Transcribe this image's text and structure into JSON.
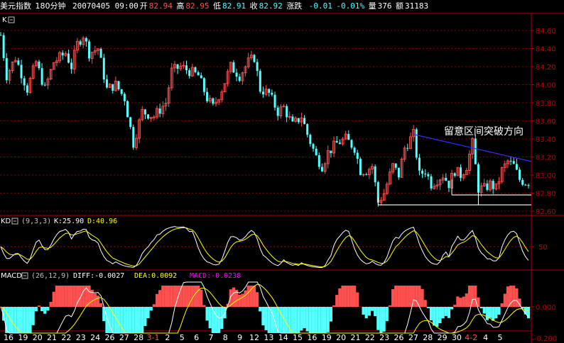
{
  "header": {
    "symbol": "美元指数",
    "period": "180分钟",
    "date_time": "20070405 09:00",
    "open_label": "开",
    "open_value": "82.94",
    "high_label": "高",
    "high_value": "82.95",
    "low_label": "低",
    "low_value": "82.91",
    "close_label": "收",
    "close_value": "82.92",
    "change_label": "涨跌",
    "change_value": "-0.01",
    "change_pct": "-0.01%",
    "volume_label": "量",
    "volume_value": "376",
    "amount_label": "额",
    "amount_value": "31183"
  },
  "panes": {
    "main": {
      "label": "K"
    },
    "kd": {
      "label": "KD",
      "params": "(9,3,3)",
      "k_text": "K:25.90",
      "d_text": "D:40.96"
    },
    "macd": {
      "label": "MACD",
      "params": "(26,12,9)",
      "diff_text": "DIFF:-0.0027",
      "dea_text": "DEA:0.0092",
      "macd_text": "MACD:-0.0238"
    }
  },
  "colors": {
    "up": "#ff5050",
    "down": "#54ffff",
    "white": "#ffffff",
    "yellow": "#ffff00",
    "magenta": "#ff00ff",
    "axis": "#b00000",
    "trend": "#3030ff",
    "tick": "#c00000"
  },
  "annotation": "留意区间突破方向",
  "chart_data": [
    {
      "type": "candlestick",
      "title": "美元指数 180分钟",
      "ylim": [
        82.6,
        84.7
      ],
      "y_ticks": [
        "84.60",
        "84.40",
        "84.20",
        "84.00",
        "83.80",
        "83.60",
        "83.40",
        "83.20",
        "83.00",
        "82.80",
        "82.60"
      ],
      "waypoints": [
        [
          0,
          84.55
        ],
        [
          2,
          84.1
        ],
        [
          5,
          84.3
        ],
        [
          9,
          83.95
        ],
        [
          12,
          84.25
        ],
        [
          15,
          83.95
        ],
        [
          18,
          84.25
        ],
        [
          22,
          84.35
        ],
        [
          24,
          84.2
        ],
        [
          26,
          84.45
        ],
        [
          28,
          84.55
        ],
        [
          30,
          84.35
        ],
        [
          33,
          84.4
        ],
        [
          36,
          83.95
        ],
        [
          39,
          84.0
        ],
        [
          42,
          83.85
        ],
        [
          45,
          83.35
        ],
        [
          48,
          83.7
        ],
        [
          52,
          83.65
        ],
        [
          56,
          83.8
        ],
        [
          58,
          84.15
        ],
        [
          61,
          84.2
        ],
        [
          64,
          84.15
        ],
        [
          67,
          84.1
        ],
        [
          70,
          83.85
        ],
        [
          72,
          83.75
        ],
        [
          75,
          83.95
        ],
        [
          78,
          84.2
        ],
        [
          81,
          84.1
        ],
        [
          84,
          84.25
        ],
        [
          86,
          84.3
        ],
        [
          88,
          83.95
        ],
        [
          91,
          83.9
        ],
        [
          94,
          83.7
        ],
        [
          96,
          83.75
        ],
        [
          99,
          83.55
        ],
        [
          102,
          83.65
        ],
        [
          104,
          83.45
        ],
        [
          107,
          83.2
        ],
        [
          109,
          83.1
        ],
        [
          111,
          83.25
        ],
        [
          114,
          83.35
        ],
        [
          117,
          83.4
        ],
        [
          120,
          83.3
        ],
        [
          122,
          83.05
        ],
        [
          124,
          83.05
        ],
        [
          126,
          83.1
        ],
        [
          128,
          82.7
        ],
        [
          130,
          82.8
        ],
        [
          133,
          83.1
        ],
        [
          135,
          83.0
        ],
        [
          137,
          83.3
        ],
        [
          139,
          83.4
        ],
        [
          140,
          83.45
        ],
        [
          142,
          83.0
        ],
        [
          144,
          83.05
        ],
        [
          146,
          82.9
        ],
        [
          148,
          82.95
        ],
        [
          150,
          83.0
        ],
        [
          152,
          82.9
        ],
        [
          154,
          83.05
        ],
        [
          156,
          83.0
        ],
        [
          158,
          83.1
        ],
        [
          160,
          83.35
        ],
        [
          162,
          82.85
        ],
        [
          164,
          82.85
        ],
        [
          166,
          82.9
        ],
        [
          168,
          82.85
        ],
        [
          170,
          83.05
        ],
        [
          172,
          83.15
        ],
        [
          174,
          83.1
        ],
        [
          176,
          82.95
        ],
        [
          178,
          82.92
        ]
      ],
      "trendlines": [
        {
          "name": "resistance",
          "from": [
            140,
            83.45
          ],
          "to": [
            190,
            83.15
          ]
        },
        {
          "name": "support-1",
          "from": [
            153,
            82.78
          ],
          "to": [
            190,
            82.78
          ]
        },
        {
          "name": "support-2",
          "from": [
            128,
            82.67
          ],
          "to": [
            190,
            82.67
          ]
        }
      ]
    },
    {
      "type": "line",
      "title": "KD (9,3,3)",
      "series": [
        {
          "name": "K",
          "value": 25.9
        },
        {
          "name": "D",
          "value": 40.96
        }
      ],
      "y_ticks": [
        "50"
      ]
    },
    {
      "type": "bar",
      "title": "MACD (26,12,9)",
      "series": [
        {
          "name": "DIFF",
          "value": -0.0027
        },
        {
          "name": "DEA",
          "value": 0.0092
        },
        {
          "name": "MACD",
          "value": -0.0238
        }
      ],
      "y_ticks": [
        "0.000",
        "-0.200"
      ],
      "x_labels": [
        {
          "t": "16",
          "red": false
        },
        {
          "t": "19",
          "red": false
        },
        {
          "t": "20",
          "red": false
        },
        {
          "t": "21",
          "red": false
        },
        {
          "t": "22",
          "red": false
        },
        {
          "t": "23",
          "red": false
        },
        {
          "t": "24",
          "red": false
        },
        {
          "t": "26",
          "red": false
        },
        {
          "t": "27",
          "red": false
        },
        {
          "t": "28",
          "red": false
        },
        {
          "t": "3-1",
          "red": true
        },
        {
          "t": "2",
          "red": false
        },
        {
          "t": "5",
          "red": false
        },
        {
          "t": "6",
          "red": false
        },
        {
          "t": "7",
          "red": false
        },
        {
          "t": "8",
          "red": false
        },
        {
          "t": "9",
          "red": false
        },
        {
          "t": "12",
          "red": false
        },
        {
          "t": "13",
          "red": false
        },
        {
          "t": "14",
          "red": false
        },
        {
          "t": "15",
          "red": false
        },
        {
          "t": "16",
          "red": false
        },
        {
          "t": "19",
          "red": false
        },
        {
          "t": "20",
          "red": false
        },
        {
          "t": "21",
          "red": false
        },
        {
          "t": "22",
          "red": false
        },
        {
          "t": "23",
          "red": false
        },
        {
          "t": "26",
          "red": false
        },
        {
          "t": "27",
          "red": false
        },
        {
          "t": "28",
          "red": false
        },
        {
          "t": "29",
          "red": false
        },
        {
          "t": "30",
          "red": false
        },
        {
          "t": "4-2",
          "red": true
        },
        {
          "t": "4",
          "red": false
        },
        {
          "t": "5",
          "red": false
        }
      ]
    }
  ]
}
